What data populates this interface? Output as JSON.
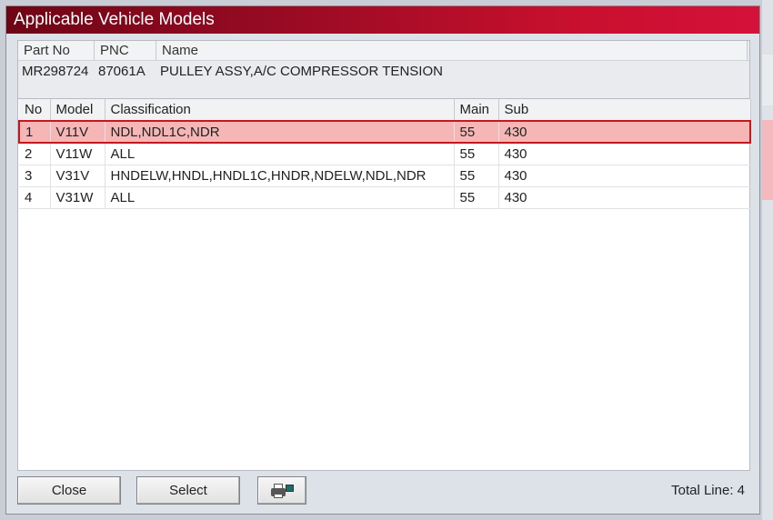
{
  "window": {
    "title": "Applicable Vehicle Models"
  },
  "part_info": {
    "headers": {
      "part_no": "Part No",
      "pnc": "PNC",
      "name": "Name"
    },
    "values": {
      "part_no": "MR298724",
      "pnc": "87061A",
      "name": "PULLEY ASSY,A/C COMPRESSOR TENSION"
    }
  },
  "grid": {
    "columns": {
      "no": "No",
      "model": "Model",
      "classification": "Classification",
      "main": "Main",
      "sub": "Sub"
    },
    "rows": [
      {
        "no": "1",
        "model": "V11V",
        "classification": "NDL,NDL1C,NDR",
        "main": "55",
        "sub": "430",
        "selected": true
      },
      {
        "no": "2",
        "model": "V11W",
        "classification": "ALL",
        "main": "55",
        "sub": "430"
      },
      {
        "no": "3",
        "model": "V31V",
        "classification": "HNDELW,HNDL,HNDL1C,HNDR,NDELW,NDL,NDR",
        "main": "55",
        "sub": "430"
      },
      {
        "no": "4",
        "model": "V31W",
        "classification": "ALL",
        "main": "55",
        "sub": "430"
      }
    ]
  },
  "footer": {
    "close_label": "Close",
    "select_label": "Select",
    "print_icon": "printer-icon",
    "total_line": "Total Line: 4"
  },
  "colors": {
    "title_gradient_start": "#6e0515",
    "title_gradient_end": "#d5113a",
    "selected_row_bg": "#f7b6b6",
    "selected_row_border": "#c4181f"
  }
}
